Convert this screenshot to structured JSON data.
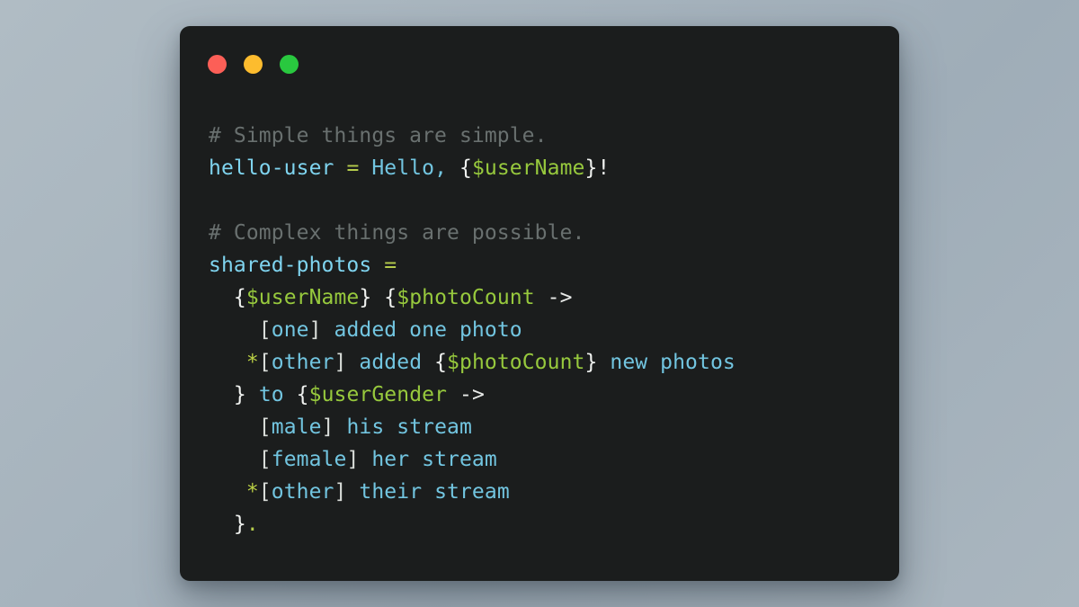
{
  "window": {
    "background_color": "#1b1d1d",
    "page_background_color": "#a6b3bd",
    "controls": [
      {
        "name": "close",
        "color": "#fc5f57"
      },
      {
        "name": "minimize",
        "color": "#fdbc2e"
      },
      {
        "name": "maximize",
        "color": "#29c83f"
      }
    ]
  },
  "editor": {
    "language": "fluent",
    "lines": [
      {
        "id": "l1",
        "tokens": [
          {
            "t": "# Simple things are simple.",
            "k": "comment"
          }
        ]
      },
      {
        "id": "l2",
        "tokens": [
          {
            "t": "hello-user",
            "k": "id"
          },
          {
            "t": " ",
            "k": "plain"
          },
          {
            "t": "=",
            "k": "eq"
          },
          {
            "t": " ",
            "k": "plain"
          },
          {
            "t": "Hello,",
            "k": "text"
          },
          {
            "t": " ",
            "k": "plain"
          },
          {
            "t": "{",
            "k": "brace"
          },
          {
            "t": "$userName",
            "k": "var"
          },
          {
            "t": "}",
            "k": "brace"
          },
          {
            "t": "!",
            "k": "brace"
          }
        ]
      },
      {
        "id": "l3",
        "tokens": []
      },
      {
        "id": "l4",
        "tokens": [
          {
            "t": "# Complex things are possible.",
            "k": "comment"
          }
        ]
      },
      {
        "id": "l5",
        "tokens": [
          {
            "t": "shared-photos",
            "k": "id"
          },
          {
            "t": " ",
            "k": "plain"
          },
          {
            "t": "=",
            "k": "eq"
          }
        ]
      },
      {
        "id": "l6",
        "tokens": [
          {
            "t": "  ",
            "k": "plain"
          },
          {
            "t": "{",
            "k": "brace"
          },
          {
            "t": "$userName",
            "k": "var"
          },
          {
            "t": "}",
            "k": "brace"
          },
          {
            "t": " ",
            "k": "plain"
          },
          {
            "t": "{",
            "k": "brace"
          },
          {
            "t": "$photoCount",
            "k": "var"
          },
          {
            "t": " ",
            "k": "plain"
          },
          {
            "t": "->",
            "k": "arrow"
          }
        ]
      },
      {
        "id": "l7",
        "tokens": [
          {
            "t": "    ",
            "k": "plain"
          },
          {
            "t": "[",
            "k": "bracket"
          },
          {
            "t": "one",
            "k": "sel"
          },
          {
            "t": "]",
            "k": "bracket"
          },
          {
            "t": " ",
            "k": "plain"
          },
          {
            "t": "added one photo",
            "k": "text"
          }
        ]
      },
      {
        "id": "l8",
        "tokens": [
          {
            "t": "   ",
            "k": "plain"
          },
          {
            "t": "*",
            "k": "star"
          },
          {
            "t": "[",
            "k": "bracket"
          },
          {
            "t": "other",
            "k": "sel"
          },
          {
            "t": "]",
            "k": "bracket"
          },
          {
            "t": " ",
            "k": "plain"
          },
          {
            "t": "added ",
            "k": "text"
          },
          {
            "t": "{",
            "k": "brace"
          },
          {
            "t": "$photoCount",
            "k": "var"
          },
          {
            "t": "}",
            "k": "brace"
          },
          {
            "t": " ",
            "k": "plain"
          },
          {
            "t": "new photos",
            "k": "text"
          }
        ]
      },
      {
        "id": "l9",
        "tokens": [
          {
            "t": "  ",
            "k": "plain"
          },
          {
            "t": "}",
            "k": "brace"
          },
          {
            "t": " ",
            "k": "plain"
          },
          {
            "t": "to",
            "k": "text"
          },
          {
            "t": " ",
            "k": "plain"
          },
          {
            "t": "{",
            "k": "brace"
          },
          {
            "t": "$userGender",
            "k": "var"
          },
          {
            "t": " ",
            "k": "plain"
          },
          {
            "t": "->",
            "k": "arrow"
          }
        ]
      },
      {
        "id": "l10",
        "tokens": [
          {
            "t": "    ",
            "k": "plain"
          },
          {
            "t": "[",
            "k": "bracket"
          },
          {
            "t": "male",
            "k": "sel"
          },
          {
            "t": "]",
            "k": "bracket"
          },
          {
            "t": " ",
            "k": "plain"
          },
          {
            "t": "his stream",
            "k": "text"
          }
        ]
      },
      {
        "id": "l11",
        "tokens": [
          {
            "t": "    ",
            "k": "plain"
          },
          {
            "t": "[",
            "k": "bracket"
          },
          {
            "t": "female",
            "k": "sel"
          },
          {
            "t": "]",
            "k": "bracket"
          },
          {
            "t": " ",
            "k": "plain"
          },
          {
            "t": "her stream",
            "k": "text"
          }
        ]
      },
      {
        "id": "l12",
        "tokens": [
          {
            "t": "   ",
            "k": "plain"
          },
          {
            "t": "*",
            "k": "star"
          },
          {
            "t": "[",
            "k": "bracket"
          },
          {
            "t": "other",
            "k": "sel"
          },
          {
            "t": "]",
            "k": "bracket"
          },
          {
            "t": " ",
            "k": "plain"
          },
          {
            "t": "their stream",
            "k": "text"
          }
        ]
      },
      {
        "id": "l13",
        "tokens": [
          {
            "t": "  ",
            "k": "plain"
          },
          {
            "t": "}",
            "k": "brace"
          },
          {
            "t": ".",
            "k": "punct"
          }
        ]
      }
    ]
  }
}
